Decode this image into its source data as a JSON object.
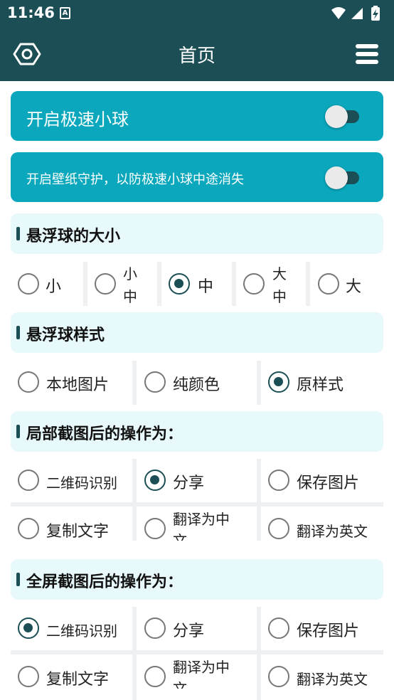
{
  "status_bar": {
    "time": "11:46",
    "notification_icon": "A"
  },
  "app_bar": {
    "title": "首页",
    "left_icon": "settings-hexagon-icon",
    "right_icon": "menu-icon"
  },
  "toggles": [
    {
      "label": "开启极速小球",
      "on": false
    },
    {
      "label": "开启壁纸守护，以防极速小球中途消失",
      "on": false
    }
  ],
  "ball_size": {
    "title": "悬浮球的大小",
    "options": [
      {
        "label": "小",
        "checked": false
      },
      {
        "label_l1": "小",
        "label_l2": "中",
        "checked": false
      },
      {
        "label": "中",
        "checked": true
      },
      {
        "label_l1": "大",
        "label_l2": "中",
        "checked": false
      },
      {
        "label": "大",
        "checked": false
      }
    ]
  },
  "ball_style": {
    "title": "悬浮球样式",
    "options": [
      {
        "label": "本地图片",
        "checked": false
      },
      {
        "label": "纯颜色",
        "checked": false
      },
      {
        "label": "原样式",
        "checked": true
      }
    ]
  },
  "partial_action": {
    "title": "局部截图后的操作为：",
    "row1": [
      {
        "label": "二维码识别",
        "checked": false
      },
      {
        "label": "分享",
        "checked": true
      },
      {
        "label": "保存图片",
        "checked": false
      }
    ],
    "row2": [
      {
        "label": "复制文字",
        "checked": false
      },
      {
        "label_l1": "翻译为中",
        "label_l2": "文",
        "checked": false
      },
      {
        "label": "翻译为英文",
        "checked": false
      }
    ]
  },
  "full_action": {
    "title": "全屏截图后的操作为：",
    "row1": [
      {
        "label": "二维码识别",
        "checked": true
      },
      {
        "label": "分享",
        "checked": false
      },
      {
        "label": "保存图片",
        "checked": false
      }
    ],
    "row2": [
      {
        "label": "复制文字",
        "checked": false
      },
      {
        "label_l1": "翻译为中",
        "label_l2": "文",
        "checked": false
      },
      {
        "label": "翻译为英文",
        "checked": false
      }
    ]
  },
  "colors": {
    "primary": "#1c4f55",
    "accent": "#0aa7bd",
    "section_bg": "#e8f9fc"
  }
}
